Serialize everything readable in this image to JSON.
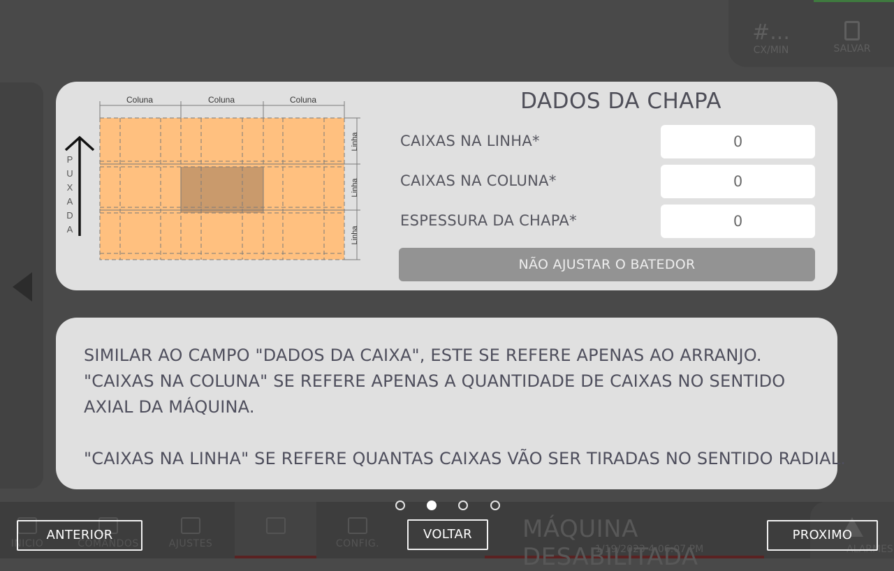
{
  "background": {
    "top_stats": [
      {
        "value": "#...",
        "label": "CX/MIN"
      },
      {
        "value": "",
        "label": "SALVAR"
      }
    ],
    "nav": [
      {
        "label": "INICIO"
      },
      {
        "label": "COMANDOS"
      },
      {
        "label": "AJUSTES"
      },
      {
        "label": ""
      },
      {
        "label": "CONFIG."
      }
    ],
    "status_title": "MÁQUINA DESABILITADA",
    "status_time": "1/19/2023 4:06:07 PM",
    "alarm_label": "ALARMES"
  },
  "diagram": {
    "column_labels": [
      "Coluna",
      "Coluna",
      "Coluna"
    ],
    "row_labels": [
      "Linha",
      "Linha",
      "Linha"
    ],
    "pull_letters": [
      "P",
      "U",
      "X",
      "A",
      "D",
      "A"
    ],
    "colors": {
      "sheet": "#ffc07f",
      "highlight": "#c99a6c",
      "lines": "#6b6b6b"
    }
  },
  "sheet_form": {
    "title": "DADOS DA CHAPA",
    "fields": [
      {
        "label": "CAIXAS NA LINHA*",
        "value": "0"
      },
      {
        "label": "CAIXAS NA COLUNA*",
        "value": "0"
      },
      {
        "label": "ESPESSURA DA CHAPA*",
        "value": "0"
      }
    ],
    "toggle_label": "NÃO AJUSTAR O BATEDOR"
  },
  "help": {
    "lines": [
      "SIMILAR AO CAMPO \"DADOS DA CAIXA\", ESTE SE REFERE APENAS AO ARRANJO.",
      "\"CAIXAS NA COLUNA\" SE REFERE APENAS A QUANTIDADE DE CAIXAS NO SENTIDO",
      "AXIAL DA MÁQUINA.",
      "\"CAIXAS NA LINHA\" SE REFERE QUANTAS CAIXAS VÃO SER TIRADAS NO SENTIDO RADIAL."
    ]
  },
  "pager": {
    "count": 4,
    "active_index": 1
  },
  "footer": {
    "prev_label": "ANTERIOR",
    "back_label": "VOLTAR",
    "next_label": "PROXIMO"
  }
}
